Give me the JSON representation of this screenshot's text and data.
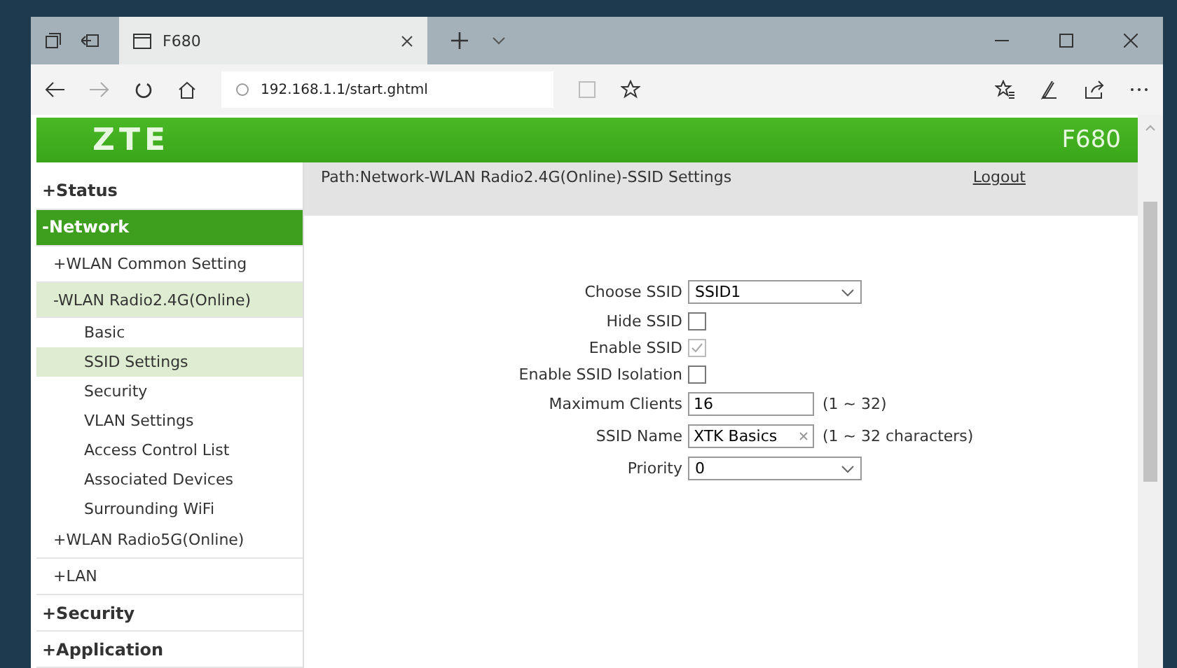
{
  "browser": {
    "tab_title": "F680",
    "address": "192.168.1.1/start.ghtml"
  },
  "header": {
    "logo": "ZTE",
    "model": "F680"
  },
  "sidebar": {
    "items": [
      {
        "label": "+Status",
        "selected": false
      },
      {
        "label": "-Network",
        "selected": true,
        "children": [
          {
            "label": "+WLAN Common Setting",
            "selected": false
          },
          {
            "label": "-WLAN Radio2.4G(Online)",
            "selected": true,
            "children": [
              {
                "label": "Basic",
                "selected": false
              },
              {
                "label": "SSID Settings",
                "selected": true
              },
              {
                "label": "Security",
                "selected": false
              },
              {
                "label": "VLAN Settings",
                "selected": false
              },
              {
                "label": "Access Control List",
                "selected": false
              },
              {
                "label": "Associated Devices",
                "selected": false
              },
              {
                "label": "Surrounding WiFi",
                "selected": false
              }
            ]
          },
          {
            "label": "+WLAN Radio5G(Online)",
            "selected": false
          },
          {
            "label": "+LAN",
            "selected": false
          }
        ]
      },
      {
        "label": "+Security",
        "selected": false
      },
      {
        "label": "+Application",
        "selected": false
      }
    ]
  },
  "path_bar": {
    "path": "Path:Network-WLAN Radio2.4G(Online)-SSID Settings",
    "logout": "Logout"
  },
  "form": [
    {
      "kind": "select",
      "label": "Choose SSID",
      "value": "SSID1"
    },
    {
      "kind": "checkbox",
      "label": "Hide SSID",
      "checked": false,
      "disabled": false
    },
    {
      "kind": "checkbox",
      "label": "Enable SSID",
      "checked": true,
      "disabled": true
    },
    {
      "kind": "checkbox",
      "label": "Enable SSID Isolation",
      "checked": false,
      "disabled": false
    },
    {
      "kind": "text",
      "label": "Maximum Clients",
      "value": "16",
      "hint": "(1 ~ 32)"
    },
    {
      "kind": "text",
      "label": "SSID Name",
      "value": "XTK Basics",
      "hint": "(1 ~ 32 characters)",
      "clearable": true
    },
    {
      "kind": "select",
      "label": "Priority",
      "value": "0"
    }
  ]
}
